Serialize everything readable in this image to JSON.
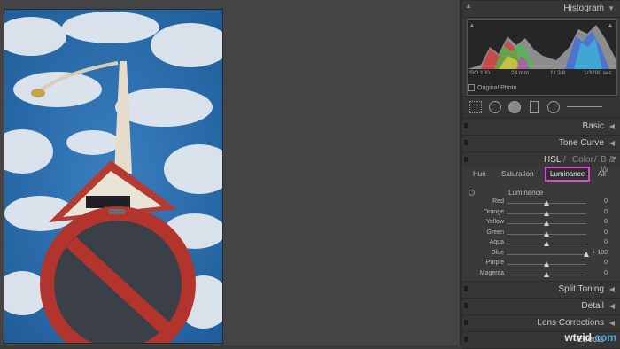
{
  "panels": {
    "histogram": "Histogram",
    "basic": "Basic",
    "tone_curve": "Tone Curve",
    "split_toning": "Split Toning",
    "detail": "Detail",
    "lens_corrections": "Lens Corrections",
    "effects": "Effects"
  },
  "histogram_meta": {
    "iso": "ISO 100",
    "focal": "24 mm",
    "aperture": "f / 3.8",
    "shutter": "1/3200 sec"
  },
  "original_photo_label": "Original Photo",
  "hsl_header": {
    "hsl": "HSL",
    "sep1": "/",
    "color": "Color",
    "sep2": "/",
    "bw": "B & W"
  },
  "tabs": {
    "hue": "Hue",
    "saturation": "Saturation",
    "luminance": "Luminance",
    "all": "All"
  },
  "luminance_title": "Luminance",
  "sliders": [
    {
      "label": "Red",
      "value": "0",
      "level": 0
    },
    {
      "label": "Orange",
      "value": "0",
      "level": 0
    },
    {
      "label": "Yellow",
      "value": "0",
      "level": 0
    },
    {
      "label": "Green",
      "value": "0",
      "level": 0
    },
    {
      "label": "Aqua",
      "value": "0",
      "level": 0
    },
    {
      "label": "Blue",
      "value": "+ 100",
      "level": 100
    },
    {
      "label": "Purple",
      "value": "0",
      "level": 0
    },
    {
      "label": "Magenta",
      "value": "0",
      "level": 0
    }
  ],
  "highlight_color": "#d84bd0",
  "watermark": {
    "prefix": "wtvid",
    "suffix": ".com"
  }
}
